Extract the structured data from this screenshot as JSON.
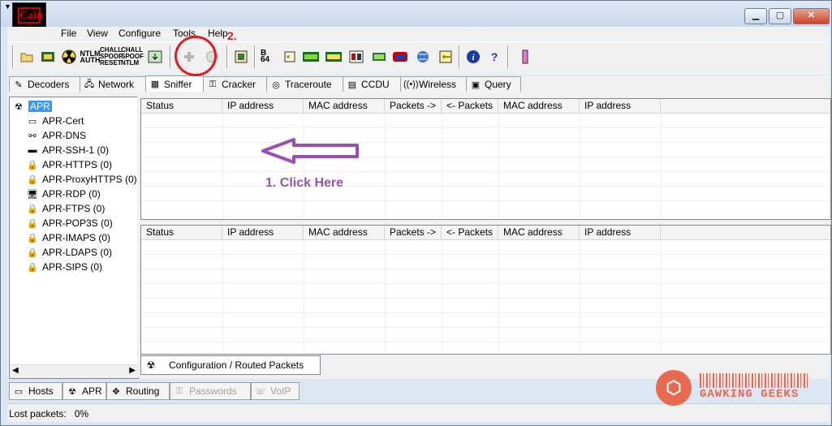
{
  "menu": [
    "File",
    "View",
    "Configure",
    "Tools",
    "Help"
  ],
  "toolbar": {
    "icons": [
      "open-folder-icon",
      "sniffer-icon",
      "apr-radiation-icon",
      "ntlm-auth-icon",
      "chall-spoof-reset-icon",
      "chall-spoof-ntlm-icon",
      "export-icon",
      "add-plus-icon",
      "shield-icon",
      "hash-icon",
      "base64-icon",
      "pwd-icon",
      "lm-icon",
      "mpo-icon",
      "dc-icon",
      "calc-icon",
      "box-icon",
      "network-icon",
      "key-icon",
      "info-icon",
      "help-icon",
      "exit-icon"
    ],
    "labels": {
      "ntlm": "NTLM AUTH",
      "chall1": "CHALL SPOOF RESET",
      "chall2": "CHALL SPOOF NTLM",
      "b64": "B 64"
    }
  },
  "tabs": [
    {
      "label": "Decoders",
      "icon": "decoders-icon"
    },
    {
      "label": "Network",
      "icon": "network-icon"
    },
    {
      "label": "Sniffer",
      "icon": "sniffer-icon"
    },
    {
      "label": "Cracker",
      "icon": "cracker-icon"
    },
    {
      "label": "Traceroute",
      "icon": "traceroute-icon"
    },
    {
      "label": "CCDU",
      "icon": "ccdu-icon"
    },
    {
      "label": "Wireless",
      "icon": "wireless-icon"
    },
    {
      "label": "Query",
      "icon": "query-icon"
    }
  ],
  "active_tab": "Sniffer",
  "tree": {
    "root": "APR",
    "items": [
      "APR-Cert",
      "APR-DNS",
      "APR-SSH-1 (0)",
      "APR-HTTPS (0)",
      "APR-ProxyHTTPS (0)",
      "APR-RDP (0)",
      "APR-FTPS (0)",
      "APR-POP3S (0)",
      "APR-IMAPS (0)",
      "APR-LDAPS (0)",
      "APR-SIPS (0)"
    ]
  },
  "grid_columns": [
    "Status",
    "IP address",
    "MAC address",
    "Packets ->",
    "<- Packets",
    "MAC address",
    "IP address"
  ],
  "bottom_panel_tab": "Configuration / Routed Packets",
  "bottom_tabs": [
    {
      "label": "Hosts",
      "enabled": true
    },
    {
      "label": "APR",
      "enabled": true
    },
    {
      "label": "Routing",
      "enabled": true
    },
    {
      "label": "Passwords",
      "enabled": false
    },
    {
      "label": "VoIP",
      "enabled": false
    }
  ],
  "status": {
    "label": "Lost packets:",
    "value": "0%"
  },
  "annotations": {
    "step1": "1. Click Here",
    "step2": "2."
  },
  "watermark": {
    "text": "GAWKING GEEKS"
  },
  "colors": {
    "annotation_red": "#e31b23",
    "annotation_purple": "#9b4fb0",
    "selection": "#3399ff"
  }
}
